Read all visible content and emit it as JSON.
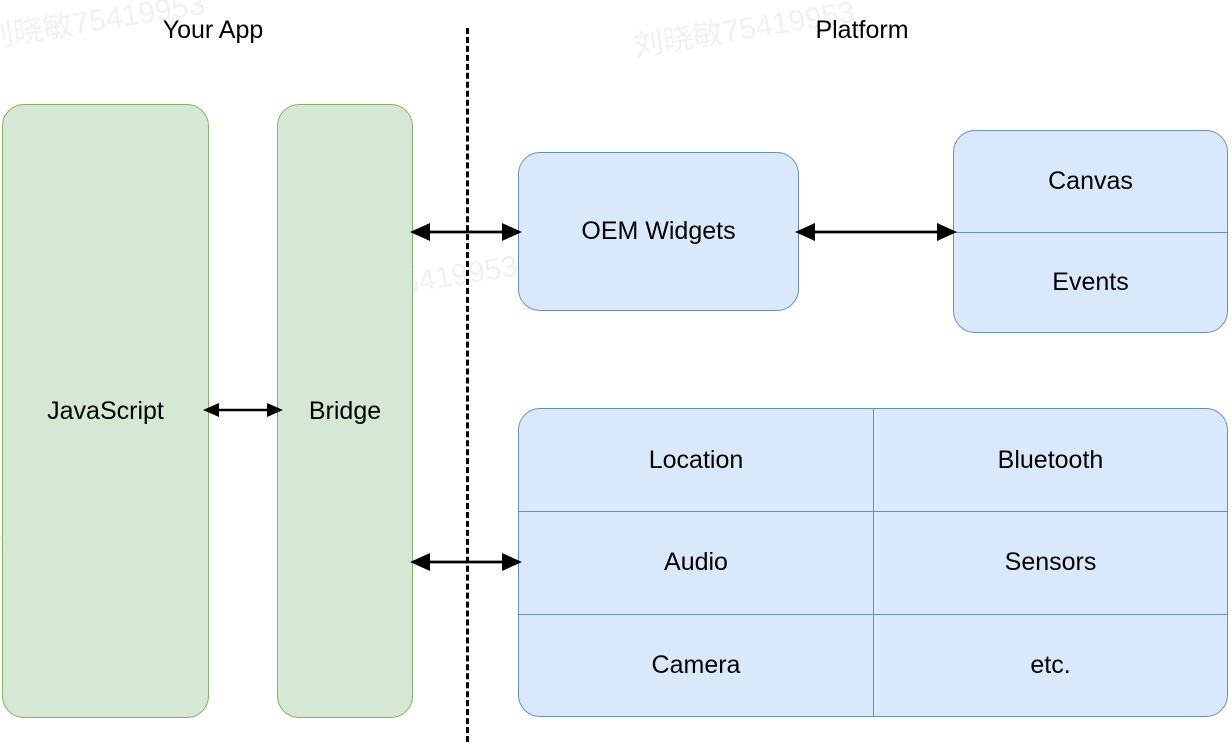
{
  "diagram": {
    "columns": [
      {
        "id": "your-app",
        "title": "Your App"
      },
      {
        "id": "platform",
        "title": "Platform"
      }
    ],
    "separator": {
      "style": "vertical-dashed-line",
      "color": "#000000"
    },
    "colors": {
      "app_fill": "#d5e8d4",
      "app_stroke": "#82b366",
      "platform_fill": "#dae8fc",
      "platform_stroke": "#6c8ebf",
      "text": "#000000",
      "background": "#ffffff"
    },
    "app_nodes": [
      {
        "id": "javascript",
        "label": "JavaScript"
      },
      {
        "id": "bridge",
        "label": "Bridge"
      }
    ],
    "platform_nodes": {
      "oem_widgets": {
        "label": "OEM Widgets"
      },
      "render_stack": {
        "cells": [
          {
            "label": "Canvas"
          },
          {
            "label": "Events"
          }
        ]
      },
      "capabilities": {
        "rows": [
          {
            "cells": [
              {
                "label": "Location"
              },
              {
                "label": "Bluetooth"
              }
            ]
          },
          {
            "cells": [
              {
                "label": "Audio"
              },
              {
                "label": "Sensors"
              }
            ]
          },
          {
            "cells": [
              {
                "label": "Camera"
              },
              {
                "label": "etc."
              }
            ]
          }
        ]
      }
    },
    "connectors": [
      {
        "id": "js-bridge",
        "from": "javascript",
        "to": "bridge",
        "kind": "bidirectional"
      },
      {
        "id": "bridge-oem",
        "from": "bridge",
        "to": "oem-widgets",
        "kind": "bidirectional"
      },
      {
        "id": "oem-render",
        "from": "oem-widgets",
        "to": "render-stack",
        "kind": "bidirectional"
      },
      {
        "id": "bridge-caps",
        "from": "bridge",
        "to": "capabilities",
        "kind": "bidirectional"
      }
    ],
    "watermark": {
      "text": "刘晓敏75419953"
    }
  }
}
